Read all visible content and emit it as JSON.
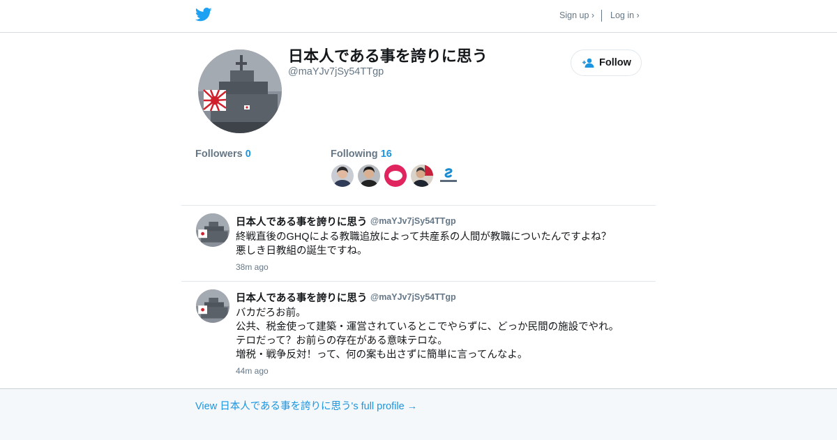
{
  "header": {
    "signup_label": "Sign up ›",
    "login_label": "Log in ›",
    "logo_icon": "twitter-bird-icon",
    "brand_color": "#1da1f2"
  },
  "profile": {
    "display_name": "日本人である事を誇りに思う",
    "handle": "@maYJv7jSy54TTgp",
    "follow_label": "Follow",
    "followers_label": "Followers",
    "followers_count": "0",
    "following_label": "Following",
    "following_count": "16"
  },
  "tweets": [
    {
      "name": "日本人である事を誇りに思う",
      "handle": "@maYJv7jSy54TTgp",
      "lines": [
        "終戦直後のGHQによる教職追放によって共産系の人間が教職についたんですよね？",
        "悪しき日教組の誕生ですね。"
      ],
      "time": "38m ago"
    },
    {
      "name": "日本人である事を誇りに思う",
      "handle": "@maYJv7jSy54TTgp",
      "lines": [
        "バカだろお前。",
        "公共、税金使って建築・運営されているとこでやらずに、どっか民間の施設でやれ。",
        "テロだって？お前らの存在がある意味テロな。",
        "増税・戦争反対！って、何の案も出さずに簡単に言ってんなよ。"
      ],
      "time": "44m ago"
    }
  ],
  "footer": {
    "link_label": "View 日本人である事を誇りに思う's full profile →"
  },
  "colors": {
    "accent": "#1b95e0",
    "muted": "#657786",
    "footer_bg": "#f5f8fa"
  }
}
